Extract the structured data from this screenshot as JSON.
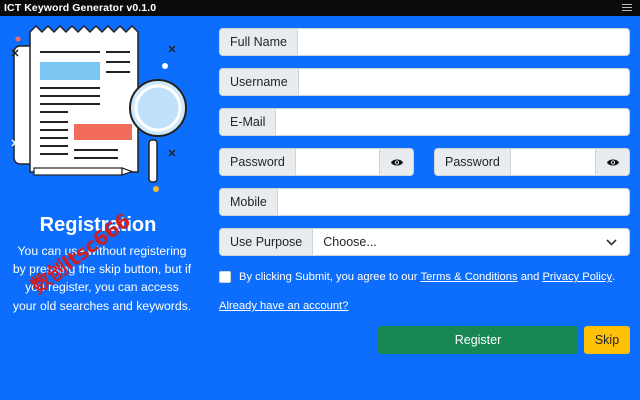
{
  "window": {
    "title": "ICT Keyword Generator v0.1.0",
    "menu_icon": "hamburger-icon"
  },
  "left_panel": {
    "illustration": "newspaper-magnifier-illustration",
    "heading": "Registration",
    "description": "You can use without registering by pressing the skip button, but if you register, you can access your old searches and keywords.",
    "watermark": "数创ltsc666"
  },
  "form": {
    "full_name": {
      "label": "Full Name",
      "value": ""
    },
    "username": {
      "label": "Username",
      "value": ""
    },
    "email": {
      "label": "E-Mail",
      "value": ""
    },
    "password": {
      "label": "Password",
      "value": "",
      "toggle_icon": "eye-icon"
    },
    "password_confirm": {
      "label": "Password",
      "value": "",
      "toggle_icon": "eye-icon"
    },
    "mobile": {
      "label": "Mobile",
      "value": ""
    },
    "use_purpose": {
      "label": "Use Purpose",
      "selected": "Choose..."
    }
  },
  "terms": {
    "checked": false,
    "prefix": "By clicking Submit, you agree to our",
    "terms_link": "Terms & Conditions",
    "and": "and",
    "privacy_link": "Privacy Policy",
    "suffix": "."
  },
  "links": {
    "already_account": "Already have an account?"
  },
  "buttons": {
    "register": "Register",
    "skip": "Skip"
  },
  "colors": {
    "background": "#0d6efd",
    "register": "#198754",
    "skip": "#ffc107",
    "titlebar": "#0b0b0b"
  }
}
